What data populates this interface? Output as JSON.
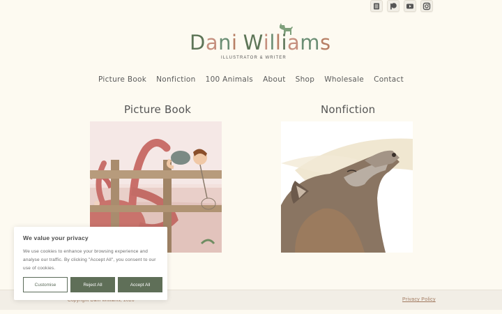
{
  "social": [
    {
      "name": "Blog",
      "icon": "blog-icon"
    },
    {
      "name": "Patreon",
      "icon": "patreon-icon"
    },
    {
      "name": "YouTube",
      "icon": "youtube-icon"
    },
    {
      "name": "Instagram",
      "icon": "instagram-icon"
    }
  ],
  "logo": {
    "title": "Dani Williams",
    "subtitle": "ILLUSTRATOR & WRITER",
    "colors": [
      "#5d7557",
      "#c58f7e",
      "#6b8e74",
      "#b77f65"
    ]
  },
  "nav": [
    "Picture Book",
    "Nonfiction",
    "100 Animals",
    "About",
    "Shop",
    "Wholesale",
    "Contact"
  ],
  "sections": [
    {
      "title": "Picture Book",
      "image_alt": "octopus-and-boy-illustration"
    },
    {
      "title": "Nonfiction",
      "image_alt": "howling-wolf-illustration"
    }
  ],
  "footer": {
    "copyright": "Copyright Dani Williams, 2026",
    "privacy": "Privacy Policy"
  },
  "cookie": {
    "title": "We value your privacy",
    "body": "We use cookies to enhance your browsing experience and analyse our traffic. By clicking \"Accept All\", you consent to our use of cookies.",
    "customise": "Customise",
    "reject": "Reject All",
    "accept": "Accept All",
    "accent": "#5f6f58"
  }
}
